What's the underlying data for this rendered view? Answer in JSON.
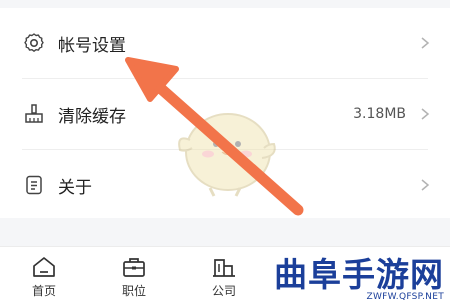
{
  "settings": {
    "items": [
      {
        "label": "帐号设置",
        "value": "",
        "icon": "gear-icon"
      },
      {
        "label": "清除缓存",
        "value": "3.18MB",
        "icon": "broom-icon"
      },
      {
        "label": "关于",
        "value": "",
        "icon": "document-icon"
      }
    ]
  },
  "tabbar": {
    "tabs": [
      {
        "label": "首页",
        "icon": "home-icon"
      },
      {
        "label": "职位",
        "icon": "briefcase-icon"
      },
      {
        "label": "公司",
        "icon": "building-icon"
      }
    ]
  },
  "watermark": {
    "title": "曲阜手游网",
    "url": "ZWFW.QFSP.NET"
  },
  "colors": {
    "arrow": "#f2744a",
    "watermark": "#1b3f9a",
    "background": "#f5f6f8"
  }
}
